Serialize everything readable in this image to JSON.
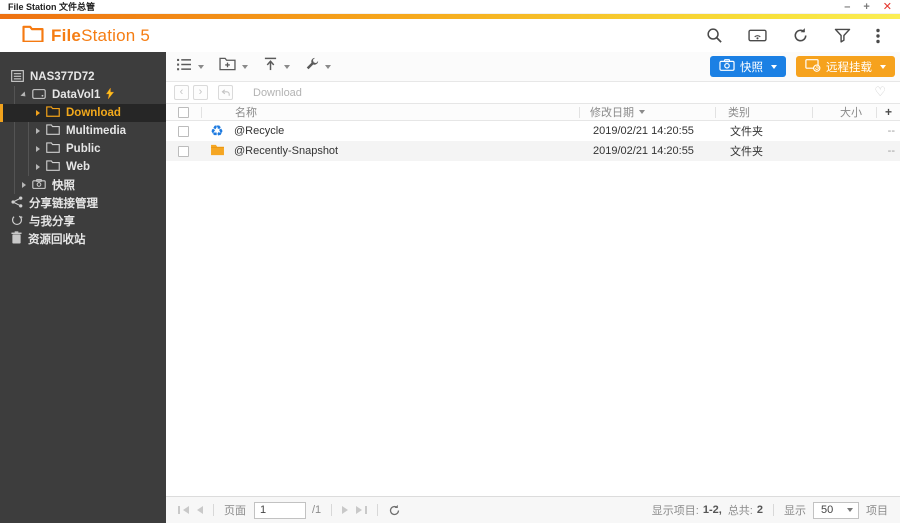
{
  "window": {
    "title": "File Station 文件总管",
    "minimize": "–",
    "maximize": "+",
    "close": "✕"
  },
  "brand": {
    "name_bold": "File",
    "name_rest": "Station 5"
  },
  "actions": {
    "snapshot": "快照",
    "remote_mount": "远程挂载"
  },
  "breadcrumb": {
    "path": "Download"
  },
  "sidebar": {
    "nas": "NAS377D72",
    "volume": "DataVol1",
    "folders": [
      "Download",
      "Multimedia",
      "Public",
      "Web"
    ],
    "snapshot": "快照",
    "share_link_mgmt": "分享链接管理",
    "shared_with_me": "与我分享",
    "recycle_bin": "资源回收站"
  },
  "table": {
    "col_name": "名称",
    "col_modified": "修改日期",
    "col_type": "类别",
    "col_size": "大小",
    "add_column": "+",
    "rows": [
      {
        "name": "@Recycle",
        "modified": "2019/02/21 14:20:55",
        "type": "文件夹",
        "size": "--"
      },
      {
        "name": "@Recently-Snapshot",
        "modified": "2019/02/21 14:20:55",
        "type": "文件夹",
        "size": "--"
      }
    ]
  },
  "footer": {
    "page_label": "页面",
    "page_value": "1",
    "page_total": "/1",
    "items_label": "显示项目:",
    "items_range": "1-2,",
    "total_label": "总共:",
    "total_value": "2",
    "display_label": "显示",
    "per_page": "50",
    "unit_label": "项目"
  },
  "icons": {
    "heart": "♡",
    "recycle": "♻",
    "back": "‹",
    "forward": "›"
  },
  "colors": {
    "accent_orange": "#f6a21d",
    "accent_blue": "#1b80e4",
    "sidebar_bg": "#3d3d3d",
    "close_red": "#e5342b"
  }
}
